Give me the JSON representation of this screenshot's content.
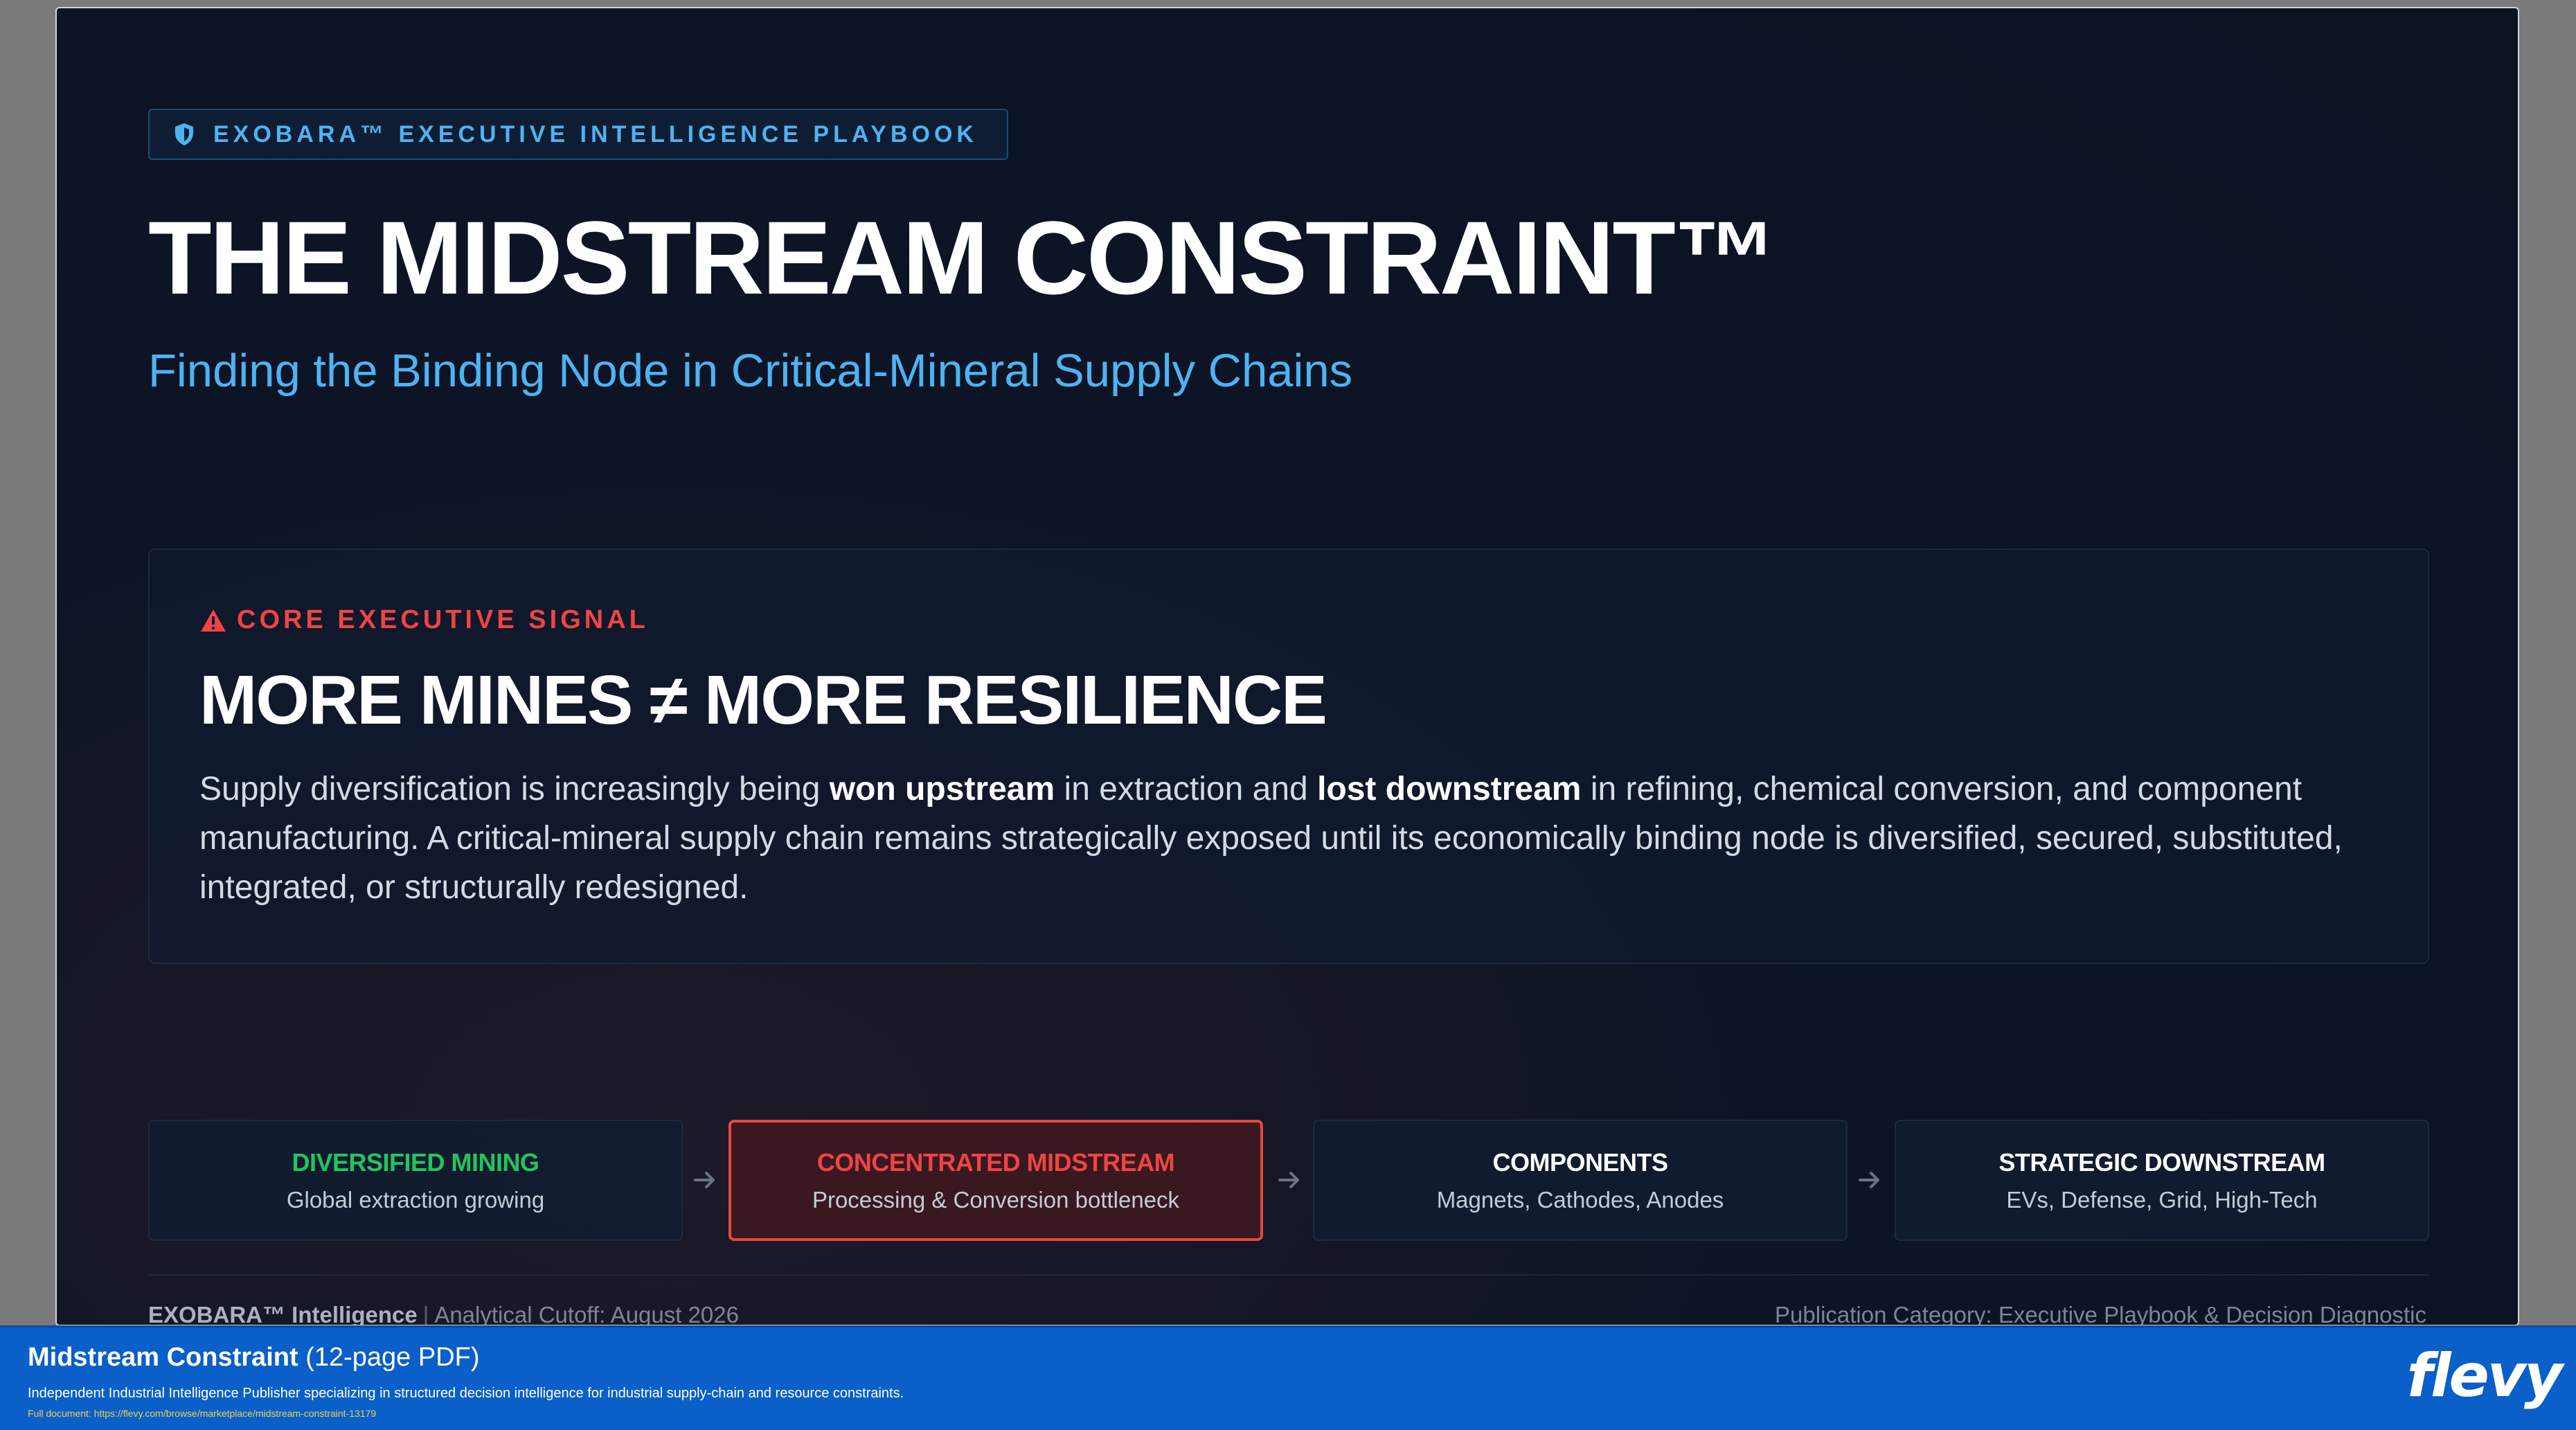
{
  "slide": {
    "tag": "EXOBARA™ EXECUTIVE INTELLIGENCE PLAYBOOK",
    "title": "THE MIDSTREAM CONSTRAINT™",
    "subtitle": "Finding the Binding Node in Critical-Mineral Supply Chains",
    "signal": {
      "label": "CORE EXECUTIVE SIGNAL",
      "heading": "MORE MINES ≠ MORE RESILIENCE",
      "body_parts": [
        "Supply diversification is increasingly being ",
        "won upstream",
        " in extraction and ",
        "lost downstream",
        " in refining, chemical conversion, and component manufacturing. A critical-mineral supply chain remains strategically exposed until its economically binding node is diversified, secured, substituted, integrated, or structurally redesigned."
      ]
    },
    "flow": [
      {
        "title": "DIVERSIFIED MINING",
        "subtitle": "Global extraction growing",
        "color": "#22c55e"
      },
      {
        "title": "CONCENTRATED MIDSTREAM",
        "subtitle": "Processing & Conversion bottleneck",
        "color": "#ef4444"
      },
      {
        "title": "COMPONENTS",
        "subtitle": "Magnets, Cathodes, Anodes",
        "color": "#ffffff"
      },
      {
        "title": "STRATEGIC DOWNSTREAM",
        "subtitle": "EVs, Defense, Grid, High-Tech",
        "color": "#ffffff"
      }
    ],
    "footer": {
      "brand": "EXOBARA™ Intelligence",
      "separator": "|",
      "cutoff": "Analytical Cutoff: August 2026",
      "category": "Publication Category: Executive Playbook & Decision Diagnostic"
    }
  },
  "banner": {
    "title": "Midstream Constraint",
    "pages": "(12-page PDF)",
    "description": "Independent Industrial Intelligence Publisher specializing in structured decision intelligence for industrial supply-chain and resource constraints.",
    "link": "Full document: https://flevy.com/browse/marketplace/midstream-constraint-13179",
    "logo": "flevy"
  },
  "colors": {
    "accent_blue": "#4fb3f0",
    "alert_red": "#ef4444",
    "banner_blue": "#0a5fc8"
  },
  "icons": {
    "tag": "shield-icon",
    "signal": "warning-triangle-icon",
    "flow_connector": "arrow-right-icon"
  }
}
